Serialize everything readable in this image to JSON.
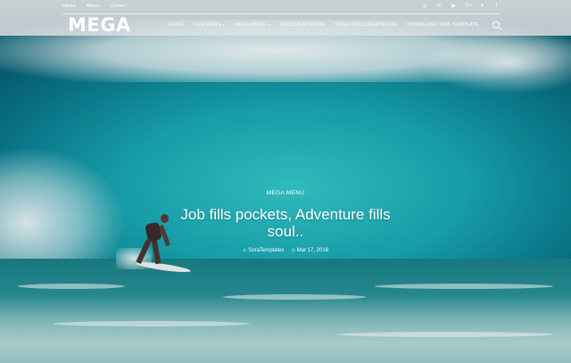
{
  "topbar": {
    "links": [
      "Home",
      "About",
      "Contact"
    ],
    "social_icons": [
      "instagram-icon",
      "pinterest-icon",
      "youtube-icon",
      "google-plus-icon",
      "twitter-icon",
      "facebook-icon"
    ],
    "social_glyphs": [
      "◎",
      "℗",
      "▶",
      "G+",
      "✦",
      "f"
    ]
  },
  "header": {
    "logo": "MEGA",
    "nav": [
      {
        "label": "HOME",
        "dropdown": false
      },
      {
        "label": "FEATURES",
        "dropdown": true
      },
      {
        "label": "MEGA MENU",
        "dropdown": true
      },
      {
        "label": "DOCUMENTATION",
        "dropdown": false
      },
      {
        "label": "VIDEO DOCUMENTATION",
        "dropdown": false
      },
      {
        "label": "DOWNLOAD THIS TEMPLATE",
        "dropdown": false
      }
    ]
  },
  "hero": {
    "category": "MEGA MENU",
    "title": "Job fills pockets, Adventure fills soul..",
    "author": "SoraTemplates",
    "date": "Mar 17, 2018"
  },
  "colors": {
    "text": "#ffffff",
    "wave": "#19a6b2"
  }
}
